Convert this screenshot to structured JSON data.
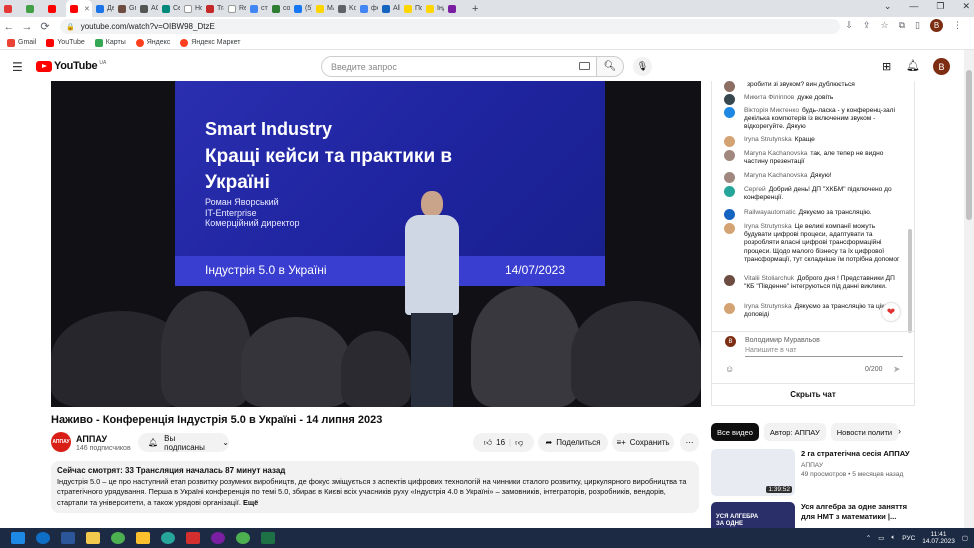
{
  "browser": {
    "tabs": [
      {
        "label": "",
        "color": "#e53935"
      },
      {
        "label": "",
        "color": "#43a047"
      },
      {
        "label": "",
        "color": "#ff0000"
      },
      {
        "label": "",
        "color": "#ff0000",
        "active": true
      },
      {
        "label": "Дел",
        "color": "#1a73e8"
      },
      {
        "label": "Gre",
        "color": "#6d4c41"
      },
      {
        "label": "ACI",
        "color": "#555555"
      },
      {
        "label": "Сер",
        "color": "#00897b"
      },
      {
        "label": "Нов",
        "color": "#ffffff"
      },
      {
        "label": "Tra",
        "color": "#c62828"
      },
      {
        "label": "Reg",
        "color": "#ffffff"
      },
      {
        "label": "ступ",
        "color": "#4285f4"
      },
      {
        "label": "con",
        "color": "#2e7d32"
      },
      {
        "label": "(5) I",
        "color": "#1877f2"
      },
      {
        "label": "MAI",
        "color": "#ffd600"
      },
      {
        "label": "Kон",
        "color": "#5f6368"
      },
      {
        "label": "фор",
        "color": "#4285f4"
      },
      {
        "label": "Allia",
        "color": "#1565c0"
      },
      {
        "label": "Пор",
        "color": "#ffd600"
      },
      {
        "label": "Інд",
        "color": "#ffd600"
      },
      {
        "label": "",
        "color": "#7b1fa2"
      }
    ],
    "new_tab": "+",
    "url": "youtube.com/watch?v=OIBW98_DtzE",
    "bookmarks": [
      "Gmail",
      "YouTube",
      "Карты",
      "Яндекс",
      "Яндекс Маркет"
    ]
  },
  "header": {
    "logo_text": "YouTube",
    "logo_country": "UA",
    "search_placeholder": "Введите запрос",
    "avatar_letter": "B"
  },
  "video": {
    "slide_line1": "Smart Industry",
    "slide_line2": "Кращі кейси та практики в",
    "slide_line3": "Україні",
    "slide_speaker": "Роман Яворський\nIT-Enterprise\nКомерційний директор",
    "slide_event": "Індустрія 5.0 в Україні",
    "slide_date": "14/07/2023",
    "title": "Наживо - Конференція Індустрія 5.0 в Україні - 14 липня 2023"
  },
  "channel": {
    "avatar_text": "АППАУ",
    "name": "АППАУ",
    "subscribers": "146 подписчиков",
    "subscribe_label": "Вы подписаны"
  },
  "actions": {
    "likes": "16",
    "share": "Поделиться",
    "save": "Сохранить"
  },
  "description": {
    "stats": "Сейчас смотрят: 33  Трансляция началась 87 минут назад",
    "text": "Індустрія 5.0 – це про наступний етап розвитку розумних виробництв, де фокус зміщується з аспектів цифрових технологій на чинники сталого розвитку, циркулярного виробництва та стратегічного урядування. Перша в Україні конференція по темі 5.0, збирає в Києві всіх учасників руху «Індустрія 4.0 в Україні» – замовників, інтеграторів, розробників, вендорів, стартапи та університети, а також урядові організації.",
    "more": "Ещё"
  },
  "chat": {
    "messages": [
      {
        "author": "",
        "text": "зробити зі звуком? вин дублюється",
        "color": "#8d6e63"
      },
      {
        "author": "Микита Філіппов",
        "text": "дуже довіть",
        "color": "#37474f"
      },
      {
        "author": "Вікторія Миктенко",
        "text": "будь-ласка - у конференц-залі декілька компютерів із включеним звуком - відкорегуйте. Дякую",
        "color": "#1e88e5"
      },
      {
        "author": "Iryna Strutynska",
        "text": "Краще",
        "color": "#d4a373"
      },
      {
        "author": "Maryna Kachanovska",
        "text": "так, але тепер не видно частину презентації",
        "color": "#a1887f"
      },
      {
        "author": "Maryna Kachanovska",
        "text": "Дякую!",
        "color": "#a1887f"
      },
      {
        "author": "Сергей",
        "text": "Добрий день! ДП \"ХКБМ\" підключено до конференції.",
        "color": "#26a69a"
      },
      {
        "author": "Railwayautomatic",
        "text": "Дякуємо за трансляцію.",
        "color": "#1565c0"
      },
      {
        "author": "Iryna Strutynska",
        "text": "Це великі компанії можуть будувати цифрові процеси, адаптувати та розробляти власні цифрові трансформаційні процеси. Щодо малого бізнесу та їх цифрової трансформації, тут складніше їм потрібна допомог",
        "color": "#d4a373"
      },
      {
        "author": "Vitalii Stoliarchuk",
        "text": "Доброго дня ! Представники ДП \"КБ \"Південне\" інтегруються під данні виклики.",
        "color": "#6d4c41"
      },
      {
        "author": "Iryna Strutynska",
        "text": "Дякуємо за трансляцію та цікаві доповіді",
        "color": "#d4a373"
      }
    ],
    "current_user_initial": "B",
    "current_user": "Володимир Муравльов",
    "input_placeholder": "Напишите в чат",
    "char_count": "0/200",
    "hide_label": "Скрыть чат"
  },
  "related": {
    "chips": [
      "Все видео",
      "Автор: АППАУ",
      "Новости полити"
    ],
    "videos": [
      {
        "title": "2 га стратегічна сесія АППАУ",
        "channel": "АППАУ",
        "meta": "49 просмотров  •  5 месяцев назад",
        "duration": "1:39:52",
        "thumb": "#e8ecf2"
      },
      {
        "title": "Уся алгебра за одне заняття для НМТ з математики |...",
        "channel": "",
        "meta": "",
        "duration": "",
        "thumb": "#2a2f6a",
        "thumb_text": "УСЯ АЛГЕБРА ЗА ОДНЕ ЗАНЯТТЯ"
      }
    ]
  },
  "taskbar": {
    "lang": "РУС",
    "time": "11:41",
    "date": "14.07.2023"
  }
}
